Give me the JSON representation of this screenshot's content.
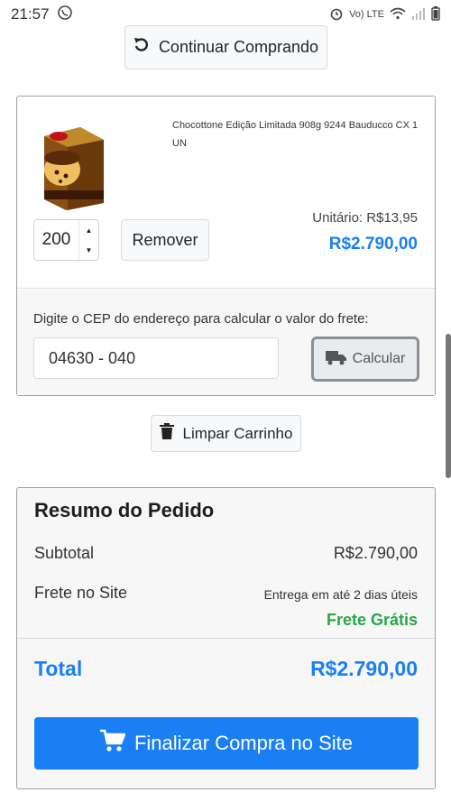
{
  "status_bar": {
    "time": "21:57",
    "network": "Vo) LTE"
  },
  "nav": {
    "continue_label": "Continuar Comprando"
  },
  "cart": {
    "items": [
      {
        "name": "Chocottone Edição Limitada 908g 9244 Bauducco CX 1 UN",
        "quantity": "200",
        "remove_label": "Remover",
        "unit_price": "Unitário: R$13,95",
        "total_price": "R$2.790,00"
      }
    ],
    "shipping": {
      "label": "Digite o CEP do endereço para calcular o valor do frete:",
      "cep_value": "04630 - 040",
      "calc_label": "Calcular"
    },
    "clear_label": "Limpar Carrinho"
  },
  "summary": {
    "title": "Resumo do Pedido",
    "subtotal_label": "Subtotal",
    "subtotal_value": "R$2.790,00",
    "shipping_label": "Frete no Site",
    "delivery_text": "Entrega em até 2 dias úteis",
    "free_shipping": "Frete Grátis",
    "total_label": "Total",
    "total_value": "R$2.790,00",
    "checkout_label": "Finalizar Compra no Site"
  },
  "colors": {
    "accent": "#1a7ff5",
    "success": "#28a745"
  }
}
